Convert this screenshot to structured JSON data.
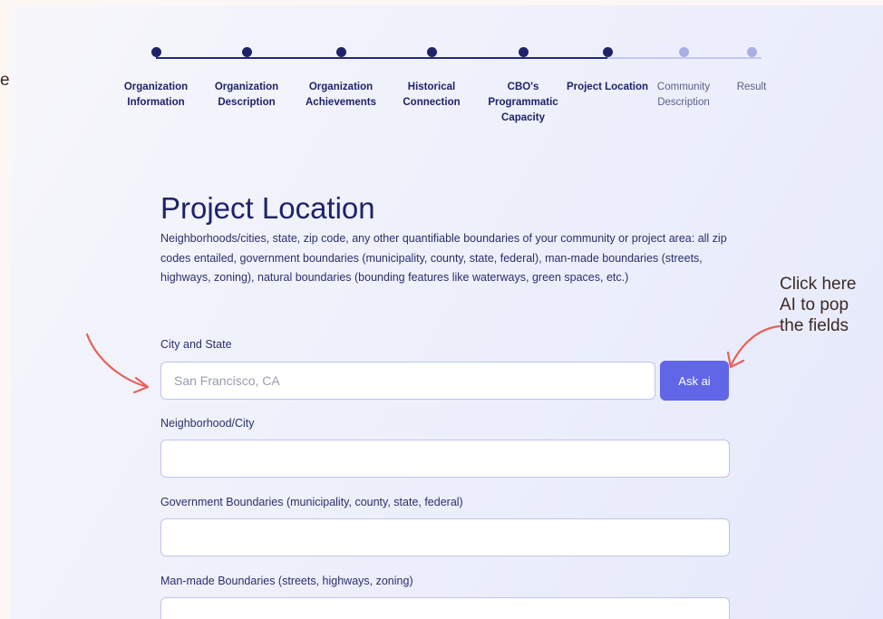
{
  "left_note": "e",
  "stepper": {
    "steps": [
      {
        "label": "Organization Information",
        "state": "done"
      },
      {
        "label": "Organization Description",
        "state": "done"
      },
      {
        "label": "Organization Achievements",
        "state": "done"
      },
      {
        "label": "Historical Connection",
        "state": "done"
      },
      {
        "label": "CBO's Programmatic Capacity",
        "state": "done"
      },
      {
        "label": "Project Location",
        "state": "current"
      },
      {
        "label": "Community Description",
        "state": "todo"
      },
      {
        "label": "Result",
        "state": "todo"
      }
    ]
  },
  "form": {
    "title": "Project Location",
    "description": "Neighborhoods/cities, state, zip code, any other quantifiable boundaries of your community or project area: all zip codes entailed, government boundaries (municipality, county, state, federal), man-made boundaries (streets, highways, zoning), natural boundaries (bounding features like waterways, green spaces, etc.)",
    "city_state": {
      "label": "City and State",
      "placeholder": "San Francisco, CA",
      "value": ""
    },
    "ask_ai_label": "Ask ai",
    "neighborhood": {
      "label": "Neighborhood/City",
      "value": ""
    },
    "gov_boundaries": {
      "label": "Government Boundaries (municipality, county, state, federal)",
      "value": ""
    },
    "manmade_boundaries": {
      "label": "Man-made Boundaries (streets, highways, zoning)",
      "value": ""
    }
  },
  "annotation": {
    "text": "Click here\nAI to pop\nthe fields"
  },
  "colors": {
    "navy": "#1e2369",
    "accent": "#6066e6",
    "arrow": "#e8615a",
    "todo": "#a8afe4"
  }
}
